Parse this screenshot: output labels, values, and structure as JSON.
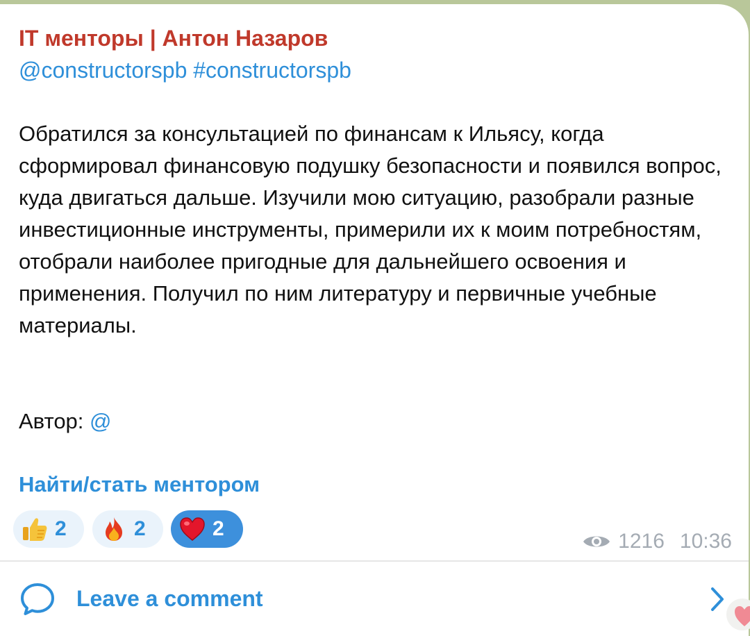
{
  "post": {
    "channel_title": "IT менторы | Антон Назаров",
    "mention_link": "@constructorspb",
    "hashtag": "#constructorspb",
    "body": "Обратился за консультацией по финансам к Ильясу, когда сформировал финансовую подушку безопасности и появился вопрос, куда двигаться дальше. Изучили мою ситуацию, разобрали разные инвестиционные инструменты, примерили их к моим потребностям, отобрали наиболее пригодные для дальнейшего освоения и применения. Получил по ним литературу и первичные учебные материалы.",
    "author_label": "Автор:",
    "author_link": "@",
    "mentor_link": "Найти/стать ментором"
  },
  "reactions": [
    {
      "emoji": "thumbs-up",
      "count": "2",
      "selected": false
    },
    {
      "emoji": "fire",
      "count": "2",
      "selected": false
    },
    {
      "emoji": "red-heart",
      "count": "2",
      "selected": true
    }
  ],
  "meta": {
    "views": "1216",
    "time": "10:36",
    "icon": "eye-icon"
  },
  "comments": {
    "label": "Leave a comment",
    "icon": "speech-bubble-icon",
    "chevron": "chevron-right-icon"
  },
  "colors": {
    "channel_title": "#c0392b",
    "link": "#2e8fd9",
    "reaction_bg": "#eaf3fb",
    "reaction_selected_bg": "#3d90dc",
    "meta_text": "#a4abb3"
  }
}
